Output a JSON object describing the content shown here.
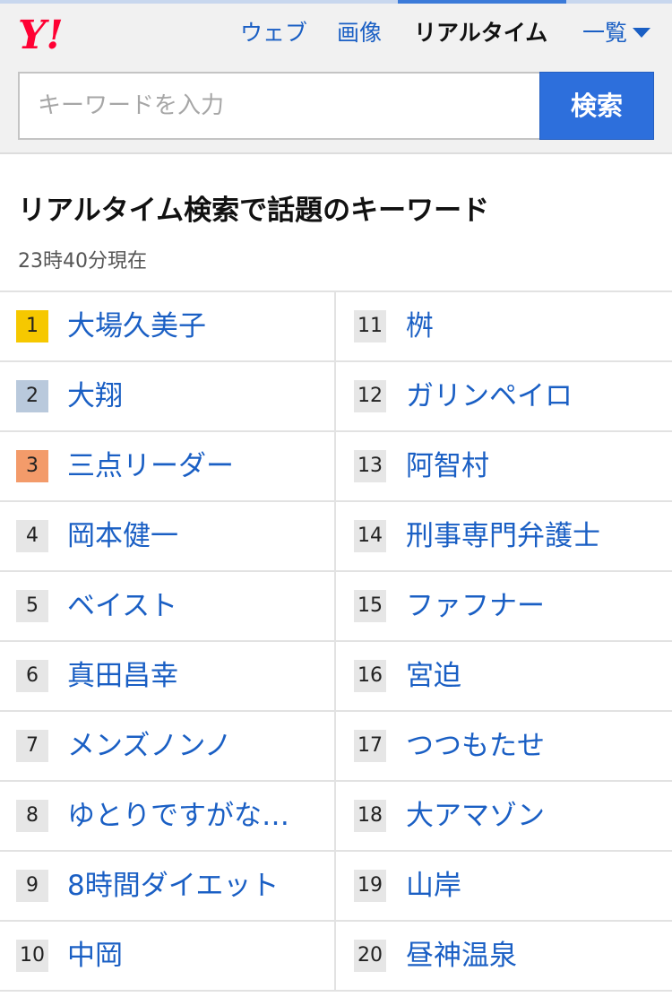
{
  "header": {
    "logo_text": "Y!",
    "nav": {
      "web": "ウェブ",
      "image": "画像",
      "realtime": "リアルタイム",
      "list": "一覧"
    }
  },
  "search": {
    "placeholder": "キーワードを入力",
    "button_label": "検索"
  },
  "section": {
    "title": "リアルタイム検索で話題のキーワード",
    "timestamp": "23時40分現在"
  },
  "colors": {
    "accent_blue": "#2d6fdc",
    "link_blue": "#1a5fc4",
    "rank1": "#f6c800",
    "rank2": "#b9c9dc",
    "rank3": "#f39b6a",
    "logo_red": "#ff0033"
  },
  "ranking": {
    "left": [
      {
        "rank": "1",
        "keyword": "大場久美子"
      },
      {
        "rank": "2",
        "keyword": "大翔"
      },
      {
        "rank": "3",
        "keyword": "三点リーダー"
      },
      {
        "rank": "4",
        "keyword": "岡本健一"
      },
      {
        "rank": "5",
        "keyword": "ベイスト"
      },
      {
        "rank": "6",
        "keyword": "真田昌幸"
      },
      {
        "rank": "7",
        "keyword": "メンズノンノ"
      },
      {
        "rank": "8",
        "keyword": "ゆとりですがな…"
      },
      {
        "rank": "9",
        "keyword": "8時間ダイエット"
      },
      {
        "rank": "10",
        "keyword": "中岡"
      }
    ],
    "right": [
      {
        "rank": "11",
        "keyword": "桝"
      },
      {
        "rank": "12",
        "keyword": "ガリンペイロ"
      },
      {
        "rank": "13",
        "keyword": "阿智村"
      },
      {
        "rank": "14",
        "keyword": "刑事専門弁護士"
      },
      {
        "rank": "15",
        "keyword": "ファフナー"
      },
      {
        "rank": "16",
        "keyword": "宮迫"
      },
      {
        "rank": "17",
        "keyword": "つつもたせ"
      },
      {
        "rank": "18",
        "keyword": "大アマゾン"
      },
      {
        "rank": "19",
        "keyword": "山岸"
      },
      {
        "rank": "20",
        "keyword": "昼神温泉"
      }
    ]
  }
}
